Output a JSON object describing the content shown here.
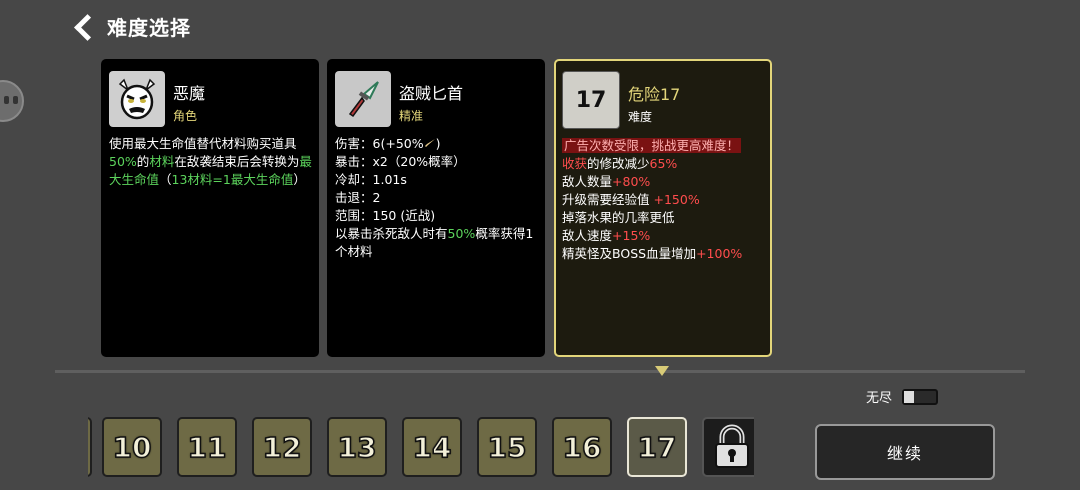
{
  "header": {
    "title": "难度选择"
  },
  "cards": {
    "character": {
      "name": "恶魔",
      "type": "角色",
      "desc": {
        "p1": "使用最大生命值替代材料购买道具",
        "p2": "50%",
        "p3": "的",
        "p4": "材料",
        "p5": "在敌袭结束后会转换为",
        "p6": "最大生命值",
        "p7": "（",
        "p8": "13材料=1最大生命值",
        "p9": "）"
      }
    },
    "weapon": {
      "name": "盗贼匕首",
      "type": "精准",
      "stats": [
        {
          "label": "伤害：",
          "value": "6(+50%",
          "suffix": ")"
        },
        {
          "label": "暴击：",
          "value": "x2（20%概率）"
        },
        {
          "label": "冷却：",
          "value": "1.01s"
        },
        {
          "label": "击退：",
          "value": "2"
        },
        {
          "label": "范围：",
          "value": "150 (近战)"
        }
      ],
      "note_pre": "以暴击杀死敌人时有",
      "note_pct": "50%",
      "note_post": "概率获得1个材料"
    },
    "difficulty": {
      "number": "17",
      "name": "危险17",
      "type": "难度",
      "warning": "广告次数受限，挑战更高难度！",
      "lines": [
        {
          "pre": "",
          "red": "收获",
          "mid": "的修改减少",
          "red2": "65%"
        },
        {
          "pre": "敌人数量",
          "red": "+80%"
        },
        {
          "pre": "升级需要经验值 ",
          "red": "+150%"
        },
        {
          "pre": "掉落水果的几率更低",
          "red": ""
        },
        {
          "pre": "敌人速度",
          "red": "+15%"
        },
        {
          "pre": "精英怪及BOSS血量增加",
          "red": "+100%"
        }
      ]
    }
  },
  "endless": {
    "label": "无尽",
    "enabled": false
  },
  "levels": [
    "10",
    "11",
    "12",
    "13",
    "14",
    "15",
    "16",
    "17"
  ],
  "selected_level": "17",
  "continue_label": "继续",
  "colors": {
    "accent": "#e3d67a",
    "positive": "#5cd35c",
    "negative": "#ff4d4d",
    "warning_bg": "#7a1212"
  }
}
